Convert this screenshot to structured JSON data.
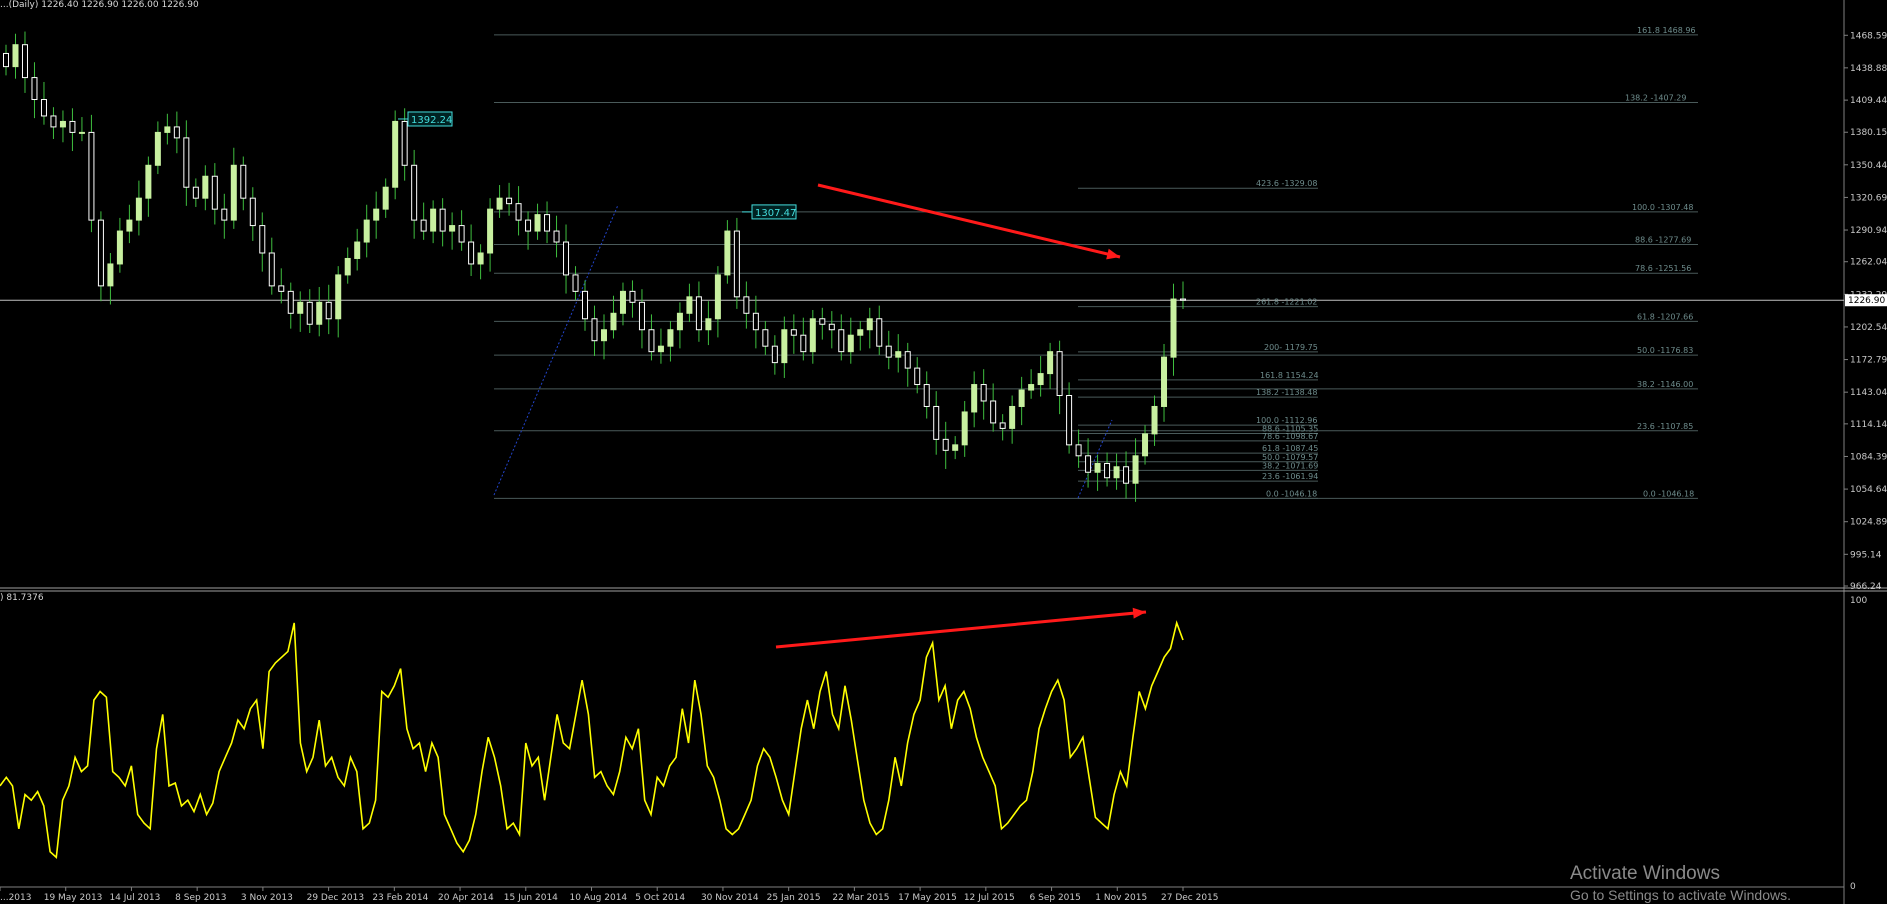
{
  "header_label": "...(Daily) 1226.40 1226.90 1226.00 1226.90",
  "indicator_label": ") 81.7376",
  "watermark": {
    "title": "Activate Windows",
    "subtitle": "Go to Settings to activate Windows."
  },
  "colors": {
    "background": "#000000",
    "bull_candle": "#c8f0a0",
    "bear_candle": "#ffffff",
    "wick": "#3fbf3f",
    "fib_line": "#4a5a5a",
    "fib_text": "#6e8c8c",
    "oscillator": "#ffff00",
    "arrow": "#ff1a1a",
    "callout": "#44dddd"
  },
  "chart_data": [
    {
      "type": "candlestick",
      "title": "",
      "ylim": [
        966.24,
        1488
      ],
      "y_ticks": [
        "1468.59",
        "1438.88",
        "1409.44",
        "1380.15",
        "1350.44",
        "1320.69",
        "1290.94",
        "1262.04",
        "1232.29",
        "1202.54",
        "1172.79",
        "1143.04",
        "1114.14",
        "1084.39",
        "1054.64",
        "1024.89",
        "995.14",
        "966.24"
      ],
      "current_price": "1226.90",
      "x_ticks": [
        "...2013",
        "19 May 2013",
        "14 Jul 2013",
        "8 Sep 2013",
        "3 Nov 2013",
        "29 Dec 2013",
        "23 Feb 2014",
        "20 Apr 2014",
        "15 Jun 2014",
        "10 Aug 2014",
        "5 Oct 2014",
        "30 Nov 2014",
        "25 Jan 2015",
        "22 Mar 2015",
        "17 May 2015",
        "12 Jul 2015",
        "6 Sep 2015",
        "1 Nov 2015",
        "27 Dec 2015"
      ],
      "callouts": [
        {
          "label": "1392.24",
          "value": 1392.24
        },
        {
          "label": "1307.47",
          "value": 1307.47
        }
      ],
      "close_series": [
        1440,
        1460,
        1430,
        1410,
        1395,
        1385,
        1390,
        1380,
        1380,
        1300,
        1240,
        1260,
        1290,
        1300,
        1320,
        1350,
        1380,
        1385,
        1375,
        1330,
        1320,
        1340,
        1310,
        1300,
        1350,
        1320,
        1295,
        1270,
        1240,
        1235,
        1215,
        1225,
        1205,
        1225,
        1210,
        1250,
        1265,
        1280,
        1300,
        1310,
        1330,
        1390,
        1350,
        1300,
        1290,
        1310,
        1290,
        1295,
        1280,
        1260,
        1270,
        1310,
        1320,
        1315,
        1300,
        1290,
        1305,
        1290,
        1280,
        1250,
        1235,
        1210,
        1190,
        1200,
        1215,
        1235,
        1225,
        1200,
        1180,
        1185,
        1200,
        1215,
        1230,
        1200,
        1210,
        1250,
        1290,
        1230,
        1215,
        1200,
        1185,
        1170,
        1200,
        1195,
        1180,
        1210,
        1205,
        1200,
        1180,
        1195,
        1200,
        1210,
        1185,
        1175,
        1180,
        1165,
        1150,
        1130,
        1100,
        1090,
        1095,
        1125,
        1150,
        1135,
        1115,
        1110,
        1130,
        1145,
        1150,
        1160,
        1180,
        1140,
        1095,
        1085,
        1070,
        1078,
        1065,
        1075,
        1060,
        1085,
        1105,
        1130,
        1175,
        1228,
        1226.9
      ],
      "fibonacci_levels": [
        {
          "label": "161.8 1468.96",
          "value": 1468.96
        },
        {
          "label": "138.2 -1407.29",
          "value": 1407.29
        },
        {
          "label": "423.6 -1329.08",
          "value": 1329.08
        },
        {
          "label": "100.0 -1307.48",
          "value": 1307.48
        },
        {
          "label": "88.6 -1277.69",
          "value": 1277.69
        },
        {
          "label": "78.6 -1251.56",
          "value": 1251.56
        },
        {
          "label": "261.8 -1221.02",
          "value": 1221.02
        },
        {
          "label": "61.8 -1207.66",
          "value": 1207.66
        },
        {
          "label": "200- 1179.75",
          "value": 1179.75
        },
        {
          "label": "50.0 -1176.83",
          "value": 1176.83
        },
        {
          "label": "161.8 1154.24",
          "value": 1154.24
        },
        {
          "label": "38.2 -1146.00",
          "value": 1146.0
        },
        {
          "label": "138.2 -1138.48",
          "value": 1138.48
        },
        {
          "label": "100.0 -1112.96",
          "value": 1112.96
        },
        {
          "label": "23.6 -1107.85",
          "value": 1107.85
        },
        {
          "label": "88.6 -1105.35",
          "value": 1105.35
        },
        {
          "label": "78.6 -1098.67",
          "value": 1098.67
        },
        {
          "label": "61.8 -1087.45",
          "value": 1087.45
        },
        {
          "label": "50.0 -1079.57",
          "value": 1079.57
        },
        {
          "label": "38.2 -1071.69",
          "value": 1071.69
        },
        {
          "label": "23.6 -1061.94",
          "value": 1061.94
        },
        {
          "label": "0.0 -1046.18",
          "value": 1046.18
        },
        {
          "label": "0.0 -1046.18",
          "value": 1046.18
        }
      ]
    },
    {
      "type": "line",
      "title": "",
      "ylim": [
        0,
        100
      ],
      "y_ticks": [
        "100",
        "0"
      ],
      "current_value": "81.7376",
      "series": [
        {
          "values": [
            35,
            38,
            35,
            20,
            32,
            30,
            33,
            28,
            12,
            10,
            30,
            35,
            45,
            40,
            42,
            65,
            68,
            66,
            40,
            38,
            35,
            42,
            25,
            22,
            20,
            48,
            60,
            35,
            36,
            28,
            30,
            26,
            32,
            25,
            29,
            40,
            45,
            50,
            58,
            55,
            62,
            65,
            48,
            75,
            78,
            80,
            82,
            92,
            50,
            40,
            45,
            58,
            42,
            45,
            38,
            35,
            45,
            40,
            20,
            22,
            30,
            68,
            66,
            70,
            76,
            55,
            48,
            50,
            40,
            50,
            45,
            25,
            20,
            15,
            12,
            16,
            25,
            40,
            52,
            45,
            35,
            20,
            22,
            18,
            50,
            42,
            45,
            30,
            45,
            60,
            50,
            48,
            60,
            72,
            60,
            38,
            40,
            35,
            32,
            40,
            52,
            48,
            55,
            30,
            25,
            38,
            35,
            42,
            45,
            62,
            50,
            72,
            60,
            42,
            38,
            30,
            20,
            18,
            20,
            25,
            30,
            42,
            48,
            45,
            38,
            30,
            25,
            40,
            55,
            65,
            55,
            68,
            75,
            60,
            55,
            70,
            58,
            44,
            30,
            22,
            18,
            20,
            30,
            45,
            35,
            50,
            60,
            65,
            80,
            85,
            65,
            70,
            55,
            65,
            68,
            62,
            52,
            45,
            40,
            35,
            20,
            22,
            25,
            28,
            30,
            40,
            55,
            62,
            68,
            72,
            65,
            45,
            48,
            52,
            38,
            24,
            22,
            20,
            32,
            40,
            35,
            52,
            68,
            62,
            70,
            75,
            80,
            83,
            92,
            86
          ]
        }
      ]
    }
  ]
}
